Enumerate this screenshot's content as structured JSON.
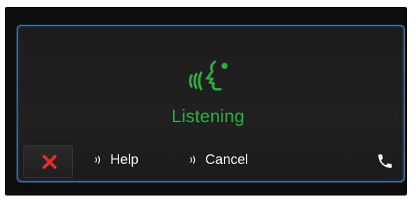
{
  "voice": {
    "status": "Listening",
    "status_color": "#22b43a"
  },
  "commands": {
    "help_label": "Help",
    "cancel_label": "Cancel"
  },
  "icons": {
    "close": "close-icon",
    "voice": "voice-recognition-icon",
    "speak": "speaker-wave-icon",
    "phone": "phone-icon"
  },
  "colors": {
    "close": "#e52b2b",
    "frame": "#3b6f9a",
    "text": "#f2f2f2"
  }
}
